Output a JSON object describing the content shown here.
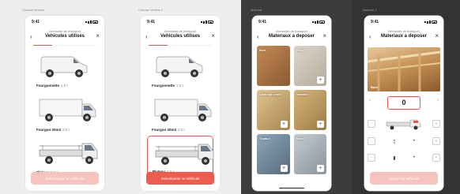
{
  "frames": [
    {
      "label": "Choose Vehicle"
    },
    {
      "label": "Choose Vehicle 2"
    },
    {
      "label": "Material"
    },
    {
      "label": "Material 2"
    }
  ],
  "status": {
    "time": "9:41"
  },
  "screen1": {
    "header_sub": "Demande de transport",
    "title": "Vehicules utilises",
    "vehicles": [
      {
        "name": "Fourgonnette",
        "capacity": "1.5 t"
      },
      {
        "name": "Fourgon 20m3",
        "capacity": "3.5 t"
      },
      {
        "name": "Plateau",
        "capacity": "3.5 t"
      }
    ],
    "cta": "Selectionner un vehicule"
  },
  "screen2": {
    "header_sub": "Demande de transport",
    "title": "Vehicules utilises",
    "vehicles": [
      {
        "name": "Fourgonnette",
        "capacity": "1.5 t"
      },
      {
        "name": "Fourgon 20m3",
        "capacity": "3.5 t"
      },
      {
        "name": "Plateau",
        "capacity": "3.5 t"
      }
    ],
    "cta": "Selectionner ce vehicule"
  },
  "screen3": {
    "header_sub": "Demande de transport",
    "title": "Materiaux a deposer",
    "tiles": [
      {
        "label": "Bois",
        "color": "#b07a4a"
      },
      {
        "label": "Placo",
        "color": "#c9c2b6"
      },
      {
        "label": "Laine de verre",
        "color": "#d2b27a"
      },
      {
        "label": "Isolants",
        "color": "#c2a06a"
      },
      {
        "label": "Tuyaux",
        "color": "#7e95a8"
      },
      {
        "label": "Metal",
        "color": "#9aa5ad"
      }
    ],
    "tile_action": "+"
  },
  "screen4": {
    "header_sub": "Demande de transport",
    "title": "Materiaux a deposer",
    "photo_label": "Bois",
    "quantity": "0",
    "cta": "Ajouter au vehicule"
  },
  "accent": "#e8564a"
}
